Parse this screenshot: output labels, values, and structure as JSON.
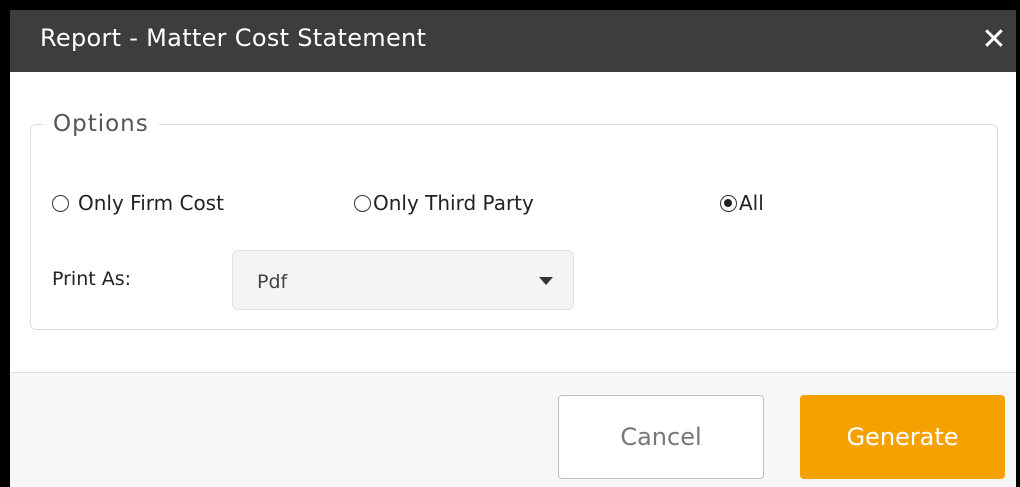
{
  "dialog": {
    "title": "Report - Matter Cost Statement",
    "close_label": "✕"
  },
  "options": {
    "legend": "Options",
    "radios": [
      {
        "label": "Only Firm Cost",
        "checked": false
      },
      {
        "label": "Only Third Party",
        "checked": false
      },
      {
        "label": "All",
        "checked": true
      }
    ],
    "print_as": {
      "label": "Print As:",
      "selected": "Pdf"
    }
  },
  "footer": {
    "cancel_label": "Cancel",
    "generate_label": "Generate"
  },
  "colors": {
    "titlebar_bg": "#3d3d3d",
    "accent": "#f5a100"
  },
  "icons": {
    "close": "close-icon",
    "dropdown": "chevron-down-icon"
  }
}
